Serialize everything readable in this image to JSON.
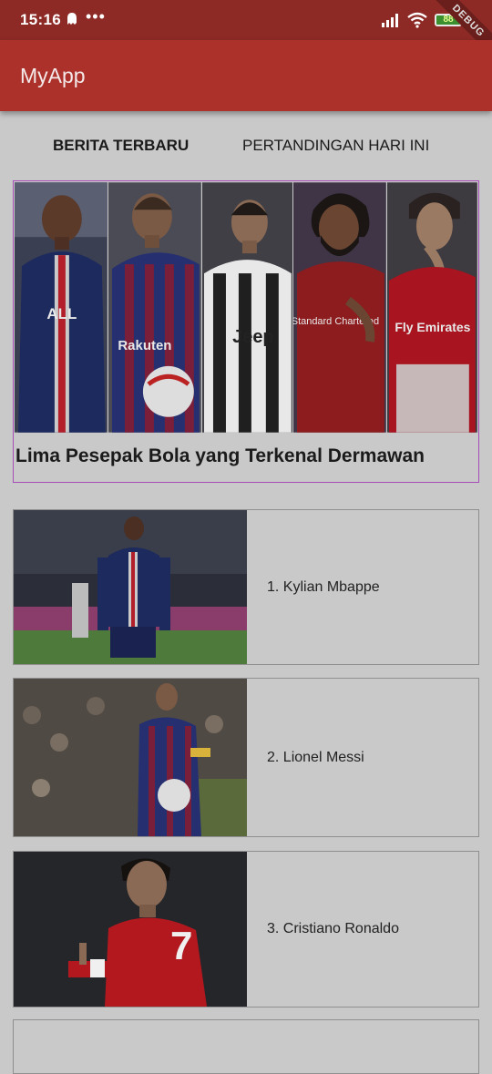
{
  "status_bar": {
    "time": "15:16",
    "dots": "•••",
    "battery": "88",
    "debug_banner": "DEBUG"
  },
  "app_bar": {
    "title": "MyApp"
  },
  "tabs": [
    {
      "label": "BERITA TERBARU",
      "active": true
    },
    {
      "label": "PERTANDINGAN HARI INI",
      "active": false
    }
  ],
  "featured": {
    "headline": "Lima Pesepak Bola yang Terkenal Dermawan",
    "players": [
      {
        "kit": "psg",
        "kit_text": "ALL"
      },
      {
        "kit": "barca",
        "kit_text": "Rakuten"
      },
      {
        "kit": "juve",
        "kit_text": "Jeep"
      },
      {
        "kit": "liverpool",
        "kit_text": "Standard Chartered"
      },
      {
        "kit": "arsenal",
        "kit_text": "Fly Emirates"
      }
    ]
  },
  "list": [
    {
      "label": "1. Kylian Mbappe",
      "kit": "psg"
    },
    {
      "label": "2. Lionel Messi",
      "kit": "barca"
    },
    {
      "label": "3. Cristiano Ronaldo",
      "kit": "manutd"
    }
  ]
}
